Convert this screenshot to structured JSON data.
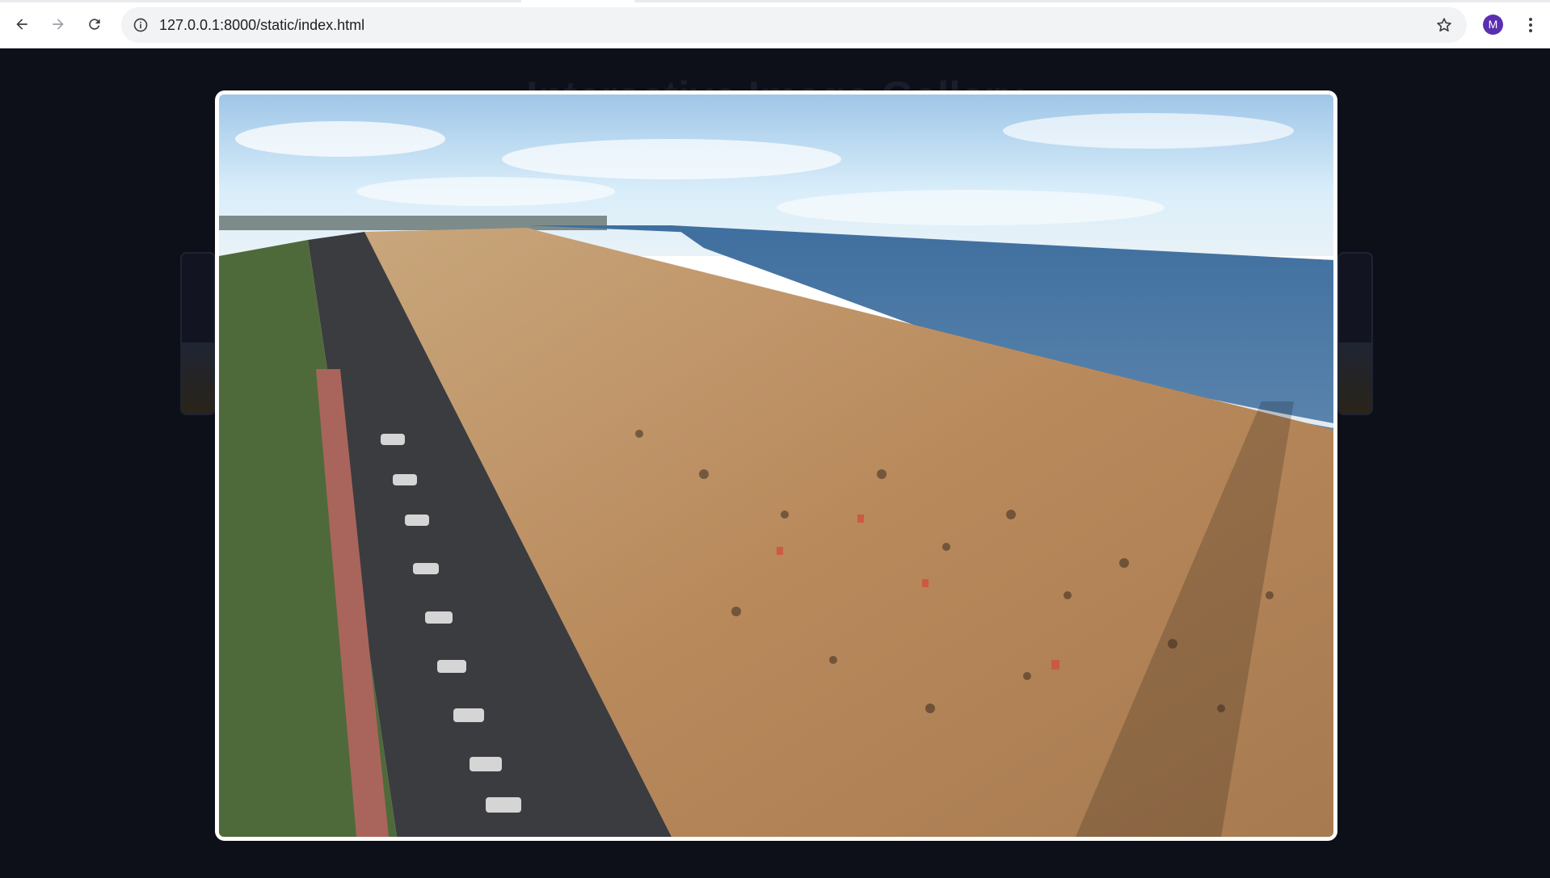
{
  "browser": {
    "url": "127.0.0.1:8000/static/index.html",
    "profile_initial": "M",
    "icons": {
      "back": "back-arrow-icon",
      "forward": "forward-arrow-icon",
      "reload": "reload-icon",
      "site_info": "info-icon",
      "bookmark": "star-icon",
      "menu": "kebab-menu-icon"
    }
  },
  "page": {
    "background": "#0d1019",
    "title": "Interactive Image Gallery"
  },
  "lightbox": {
    "image_subject": "aerial-beach-photo",
    "frame_color": "#ffffff"
  }
}
